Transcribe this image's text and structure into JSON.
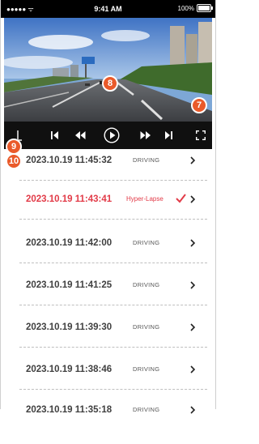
{
  "status_bar": {
    "signal": "●●●●● ᯤ",
    "time": "9:41 AM",
    "battery": "100%"
  },
  "badges": {
    "video_center": "8",
    "video_right": "7",
    "controls_left": "9",
    "list_left": "10"
  },
  "controls": {
    "icons": [
      "download-icon",
      "skip-back-icon",
      "rewind-icon",
      "play-icon",
      "fast-forward-icon",
      "skip-forward-icon",
      "fullscreen-icon"
    ]
  },
  "recordings": [
    {
      "datetime": "2023.10.19 11:45:32",
      "mode": "DRIVING",
      "highlighted": false
    },
    {
      "datetime": "2023.10.19 11:43:41",
      "mode": "Hyper-Lapse",
      "highlighted": true
    },
    {
      "datetime": "2023.10.19 11:42:00",
      "mode": "DRIVING",
      "highlighted": false
    },
    {
      "datetime": "2023.10.19 11:41:25",
      "mode": "DRIVING",
      "highlighted": false
    },
    {
      "datetime": "2023.10.19 11:39:30",
      "mode": "DRIVING",
      "highlighted": false
    },
    {
      "datetime": "2023.10.19 11:38:46",
      "mode": "DRIVING",
      "highlighted": false
    },
    {
      "datetime": "2023.10.19 11:35:18",
      "mode": "DRIVING",
      "highlighted": false
    }
  ],
  "colors": {
    "accent": "#e23b48",
    "badge": "#ea5a2a",
    "control_bar": "#101010"
  }
}
